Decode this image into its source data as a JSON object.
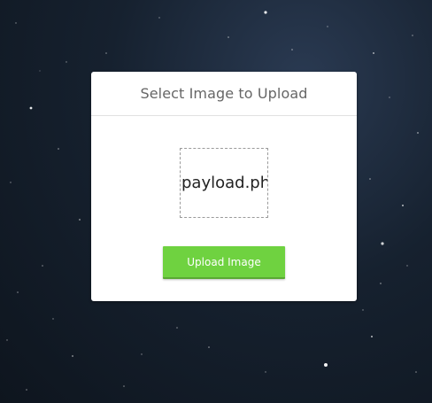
{
  "background": {
    "name": "space-starfield",
    "colors": [
      "#0e151e",
      "#16212f",
      "#2a3a52"
    ]
  },
  "upload_panel": {
    "title": "Select Image to Upload",
    "selected_file": "payload.php",
    "upload_button_label": "Upload Image",
    "accent_color": "#6fd240"
  }
}
